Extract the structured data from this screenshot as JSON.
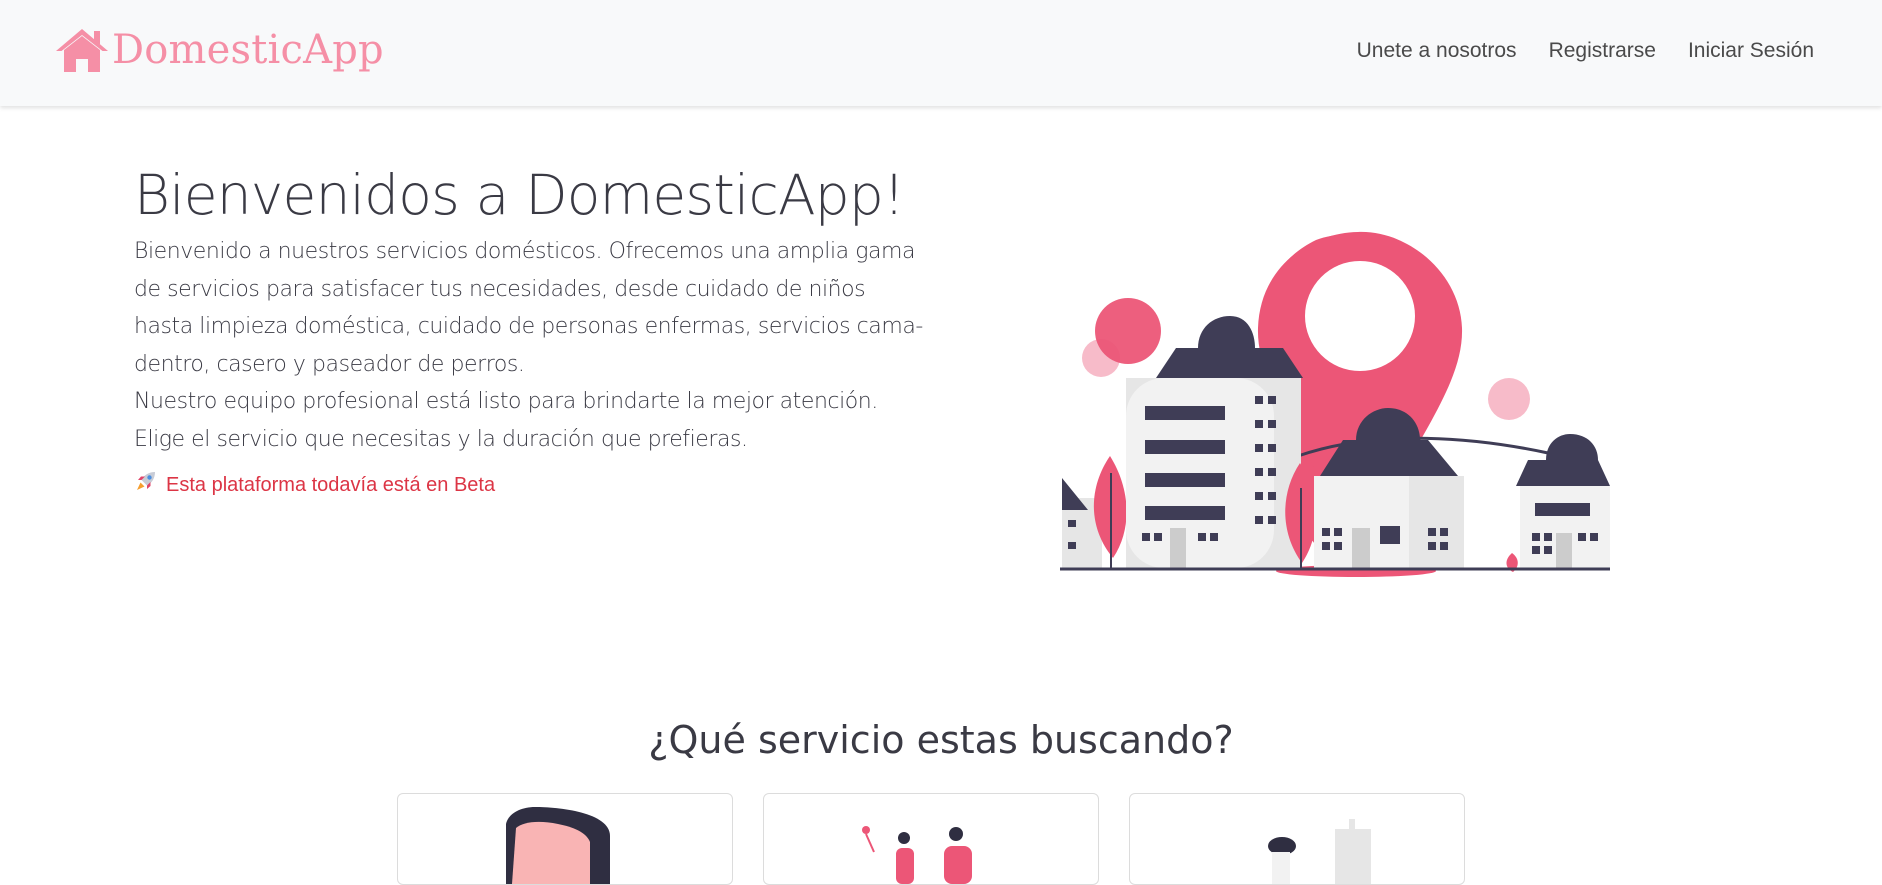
{
  "navbar": {
    "brand": "DomesticApp",
    "brand_icon": "house-icon",
    "links": [
      {
        "label": "Unete a nosotros"
      },
      {
        "label": "Registrarse"
      },
      {
        "label": "Iniciar Sesión"
      }
    ]
  },
  "hero": {
    "title": "Bienvenidos a DomesticApp!",
    "paragraph_1": "Bienvenido a nuestros servicios domésticos. Ofrecemos una amplia gama de servicios para satisfacer tus necesidades, desde cuidado de niños hasta limpieza doméstica, cuidado de personas enfermas, servicios cama-dentro, casero y paseador de perros.",
    "paragraph_2": "Nuestro equipo profesional está listo para brindarte la mejor atención.",
    "paragraph_3": "Elige el servicio que necesitas y la duración que prefieras.",
    "beta_icon": "rocket-icon",
    "beta_note": "Esta plataforma todavía está en Beta"
  },
  "services": {
    "title": "¿Qué servicio estas buscando?"
  },
  "colors": {
    "brand_pink": "#f58fa6",
    "accent_pink": "#ec5677",
    "dark_building": "#3f3d56",
    "beta_red": "#dc3545",
    "navbar_bg": "#f8f9fa"
  }
}
